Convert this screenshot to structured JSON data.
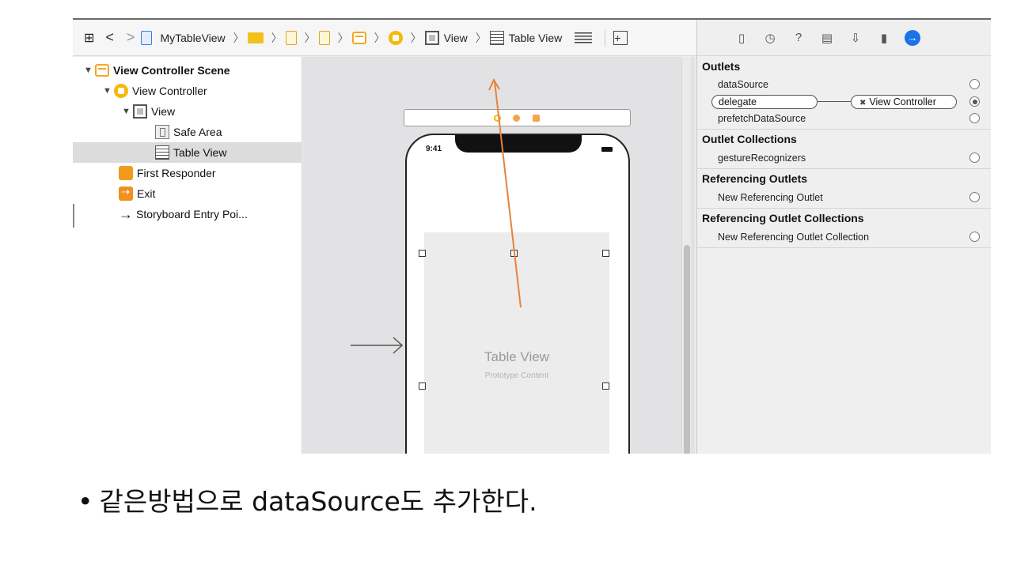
{
  "jumpbar": {
    "project": "MyTableView",
    "view": "View",
    "table_view": "Table View"
  },
  "outline": {
    "scene": "View Controller Scene",
    "view_controller": "View Controller",
    "view": "View",
    "safe_area": "Safe Area",
    "table_view": "Table View",
    "first_responder": "First Responder",
    "exit": "Exit",
    "entry_point": "Storyboard Entry Poi..."
  },
  "canvas": {
    "clock": "9:41",
    "table_title": "Table View",
    "table_subtitle": "Prototype Content"
  },
  "inspector": {
    "outlets_header": "Outlets",
    "outlets": [
      "dataSource",
      "delegate",
      "prefetchDataSource"
    ],
    "delegate_target": "View Controller",
    "outlet_collections_header": "Outlet Collections",
    "outlet_collections": [
      "gestureRecognizers"
    ],
    "referencing_outlets_header": "Referencing Outlets",
    "referencing_outlets": [
      "New Referencing Outlet"
    ],
    "referencing_collections_header": "Referencing Outlet Collections",
    "referencing_collections": [
      "New Referencing Outlet Collection"
    ]
  },
  "caption": "같은방법으로 dataSource도  추가한다.",
  "colors": {
    "connection_line": "#e8823a",
    "accent": "#1a73e8",
    "vc_icon": "#f5b90a"
  }
}
